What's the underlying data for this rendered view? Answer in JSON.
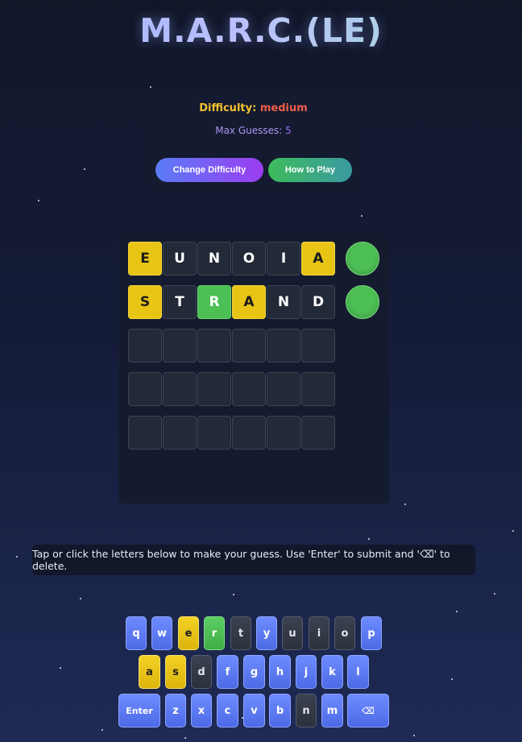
{
  "app": {
    "title": "M.A.R.C.(LE)"
  },
  "settings": {
    "difficulty_label": "Difficulty:",
    "difficulty_value": "medium",
    "max_guesses_label": "Max Guesses:",
    "max_guesses_value": "5",
    "change_difficulty_button": "Change Difficulty",
    "how_to_play_button": "How to Play"
  },
  "board": {
    "rows": [
      {
        "tiles": [
          {
            "letter": "E",
            "state": "present"
          },
          {
            "letter": "U",
            "state": "absent"
          },
          {
            "letter": "N",
            "state": "absent"
          },
          {
            "letter": "O",
            "state": "absent"
          },
          {
            "letter": "I",
            "state": "absent"
          },
          {
            "letter": "A",
            "state": "present"
          }
        ],
        "indicator": "green"
      },
      {
        "tiles": [
          {
            "letter": "S",
            "state": "present"
          },
          {
            "letter": "T",
            "state": "absent"
          },
          {
            "letter": "R",
            "state": "correct"
          },
          {
            "letter": "A",
            "state": "present"
          },
          {
            "letter": "N",
            "state": "absent"
          },
          {
            "letter": "D",
            "state": "absent"
          }
        ],
        "indicator": "green"
      },
      {
        "tiles": [
          {
            "letter": "",
            "state": "empty"
          },
          {
            "letter": "",
            "state": "empty"
          },
          {
            "letter": "",
            "state": "empty"
          },
          {
            "letter": "",
            "state": "empty"
          },
          {
            "letter": "",
            "state": "empty"
          },
          {
            "letter": "",
            "state": "empty"
          }
        ],
        "indicator": "none"
      },
      {
        "tiles": [
          {
            "letter": "",
            "state": "empty"
          },
          {
            "letter": "",
            "state": "empty"
          },
          {
            "letter": "",
            "state": "empty"
          },
          {
            "letter": "",
            "state": "empty"
          },
          {
            "letter": "",
            "state": "empty"
          },
          {
            "letter": "",
            "state": "empty"
          }
        ],
        "indicator": "none"
      },
      {
        "tiles": [
          {
            "letter": "",
            "state": "empty"
          },
          {
            "letter": "",
            "state": "empty"
          },
          {
            "letter": "",
            "state": "empty"
          },
          {
            "letter": "",
            "state": "empty"
          },
          {
            "letter": "",
            "state": "empty"
          },
          {
            "letter": "",
            "state": "empty"
          }
        ],
        "indicator": "none"
      }
    ]
  },
  "instructions": "Tap or click the letters below to make your guess. Use 'Enter' to submit and '⌫' to delete.",
  "keyboard": {
    "rows": [
      [
        {
          "label": "q",
          "state": "default"
        },
        {
          "label": "w",
          "state": "default"
        },
        {
          "label": "e",
          "state": "present"
        },
        {
          "label": "r",
          "state": "correct"
        },
        {
          "label": "t",
          "state": "absent"
        },
        {
          "label": "y",
          "state": "default"
        },
        {
          "label": "u",
          "state": "absent"
        },
        {
          "label": "i",
          "state": "absent"
        },
        {
          "label": "o",
          "state": "absent"
        },
        {
          "label": "p",
          "state": "default"
        }
      ],
      [
        {
          "label": "a",
          "state": "present"
        },
        {
          "label": "s",
          "state": "present"
        },
        {
          "label": "d",
          "state": "absent"
        },
        {
          "label": "f",
          "state": "default"
        },
        {
          "label": "g",
          "state": "default"
        },
        {
          "label": "h",
          "state": "default"
        },
        {
          "label": "j",
          "state": "default"
        },
        {
          "label": "k",
          "state": "default"
        },
        {
          "label": "l",
          "state": "default"
        }
      ],
      [
        {
          "label": "Enter",
          "state": "default"
        },
        {
          "label": "z",
          "state": "default"
        },
        {
          "label": "x",
          "state": "default"
        },
        {
          "label": "c",
          "state": "default"
        },
        {
          "label": "v",
          "state": "default"
        },
        {
          "label": "b",
          "state": "default"
        },
        {
          "label": "n",
          "state": "absent"
        },
        {
          "label": "m",
          "state": "default"
        },
        {
          "label": "⌫",
          "state": "default"
        }
      ]
    ]
  },
  "colors": {
    "present": "#e8c414",
    "correct": "#4cbf55",
    "absent": "#2c313d",
    "key_default": "#5b79f0"
  }
}
